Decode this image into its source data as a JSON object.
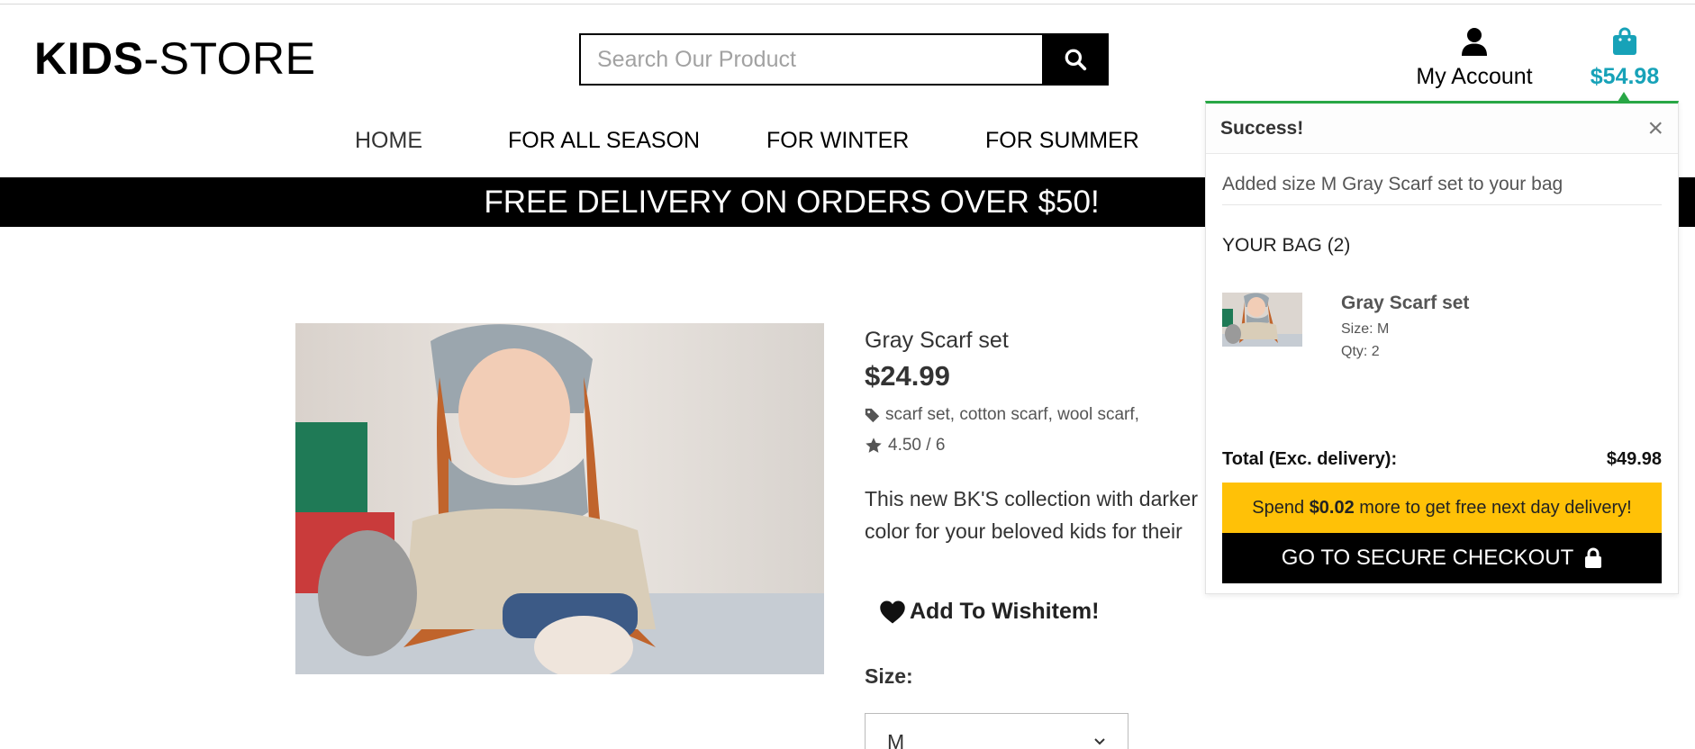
{
  "header": {
    "logo_bold": "KIDS",
    "logo_rest": "-STORE",
    "search_placeholder": "Search Our Product",
    "account_label": "My Account",
    "bag_total": "$54.98"
  },
  "nav": {
    "items": [
      "HOME",
      "FOR ALL SEASON",
      "FOR WINTER",
      "FOR SUMMER"
    ]
  },
  "banner": {
    "text": "FREE DELIVERY ON ORDERS OVER $50!"
  },
  "product": {
    "name": "Gray Scarf set",
    "price": "$24.99",
    "tags": "scarf set, cotton scarf, wool scarf,",
    "rating": "4.50 / 6",
    "description": "This new BK'S collection with darker color for your beloved kids for their Winter",
    "wishlist_label": "Add To Wishitem!",
    "size_label": "Size:",
    "size_selected": "M"
  },
  "toast": {
    "title": "Success!",
    "close": "×",
    "message": "Added size M Gray Scarf set to your bag",
    "bag_count": "YOUR BAG (2)",
    "item": {
      "name": "Gray Scarf set",
      "size": "Size: M",
      "qty": "Qty: 2"
    },
    "total_label": "Total (Exc. delivery):",
    "total_value": "$49.98",
    "spend_prefix": "Spend ",
    "spend_amount": "$0.02",
    "spend_suffix": " more to get free next day delivery!",
    "checkout_label": "GO TO SECURE CHECKOUT"
  },
  "colors": {
    "accent": "#17a2b8",
    "success": "#28a745",
    "warning": "#ffc107"
  },
  "icons": {
    "search": "search-icon",
    "account": "user-icon",
    "bag": "shopping-bag-icon",
    "tag": "tag-icon",
    "star": "star-icon",
    "heart": "heart-icon",
    "lock": "lock-icon",
    "chevron": "chevron-down-icon"
  }
}
